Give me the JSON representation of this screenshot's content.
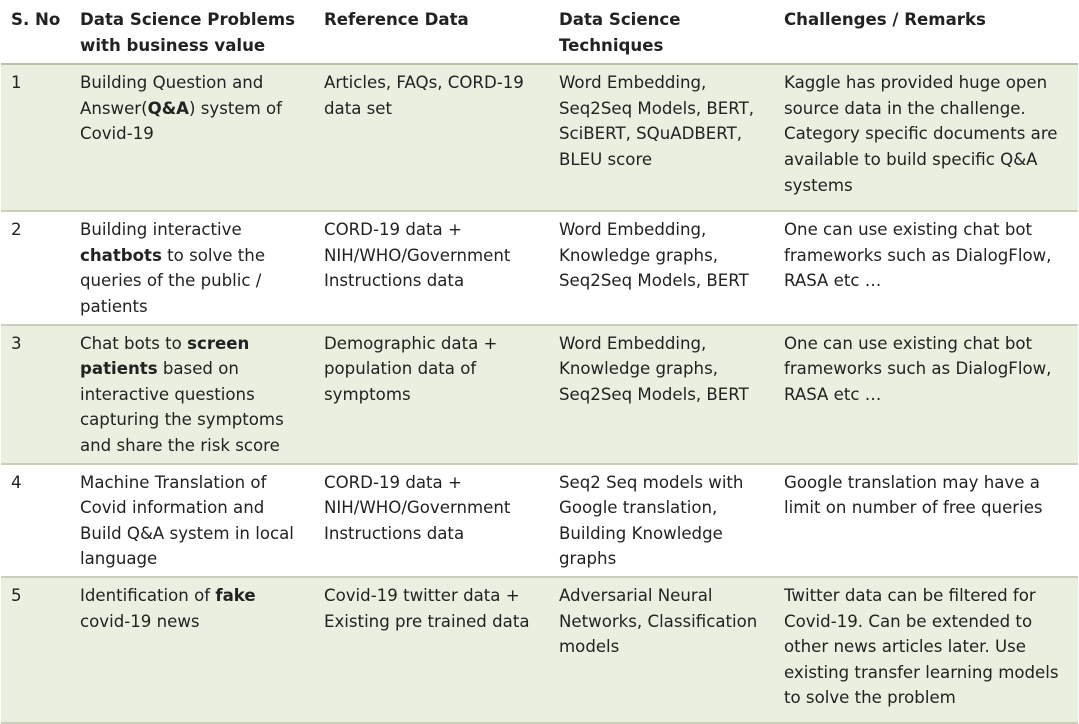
{
  "table": {
    "headers": [
      "S. No",
      "Data Science Problems with business value",
      "Reference Data",
      "Data Science Techniques",
      "Challenges / Remarks"
    ],
    "rows": [
      {
        "sno": "1",
        "problem_pre": "Building Question and Answer(",
        "problem_bold": "Q&A",
        "problem_post": ")  system of Covid-19",
        "reference": "Articles, FAQs, CORD-19 data set",
        "techniques": "Word Embedding, Seq2Seq Models, BERT, SciBERT, SQuADBERT, BLEU score",
        "remarks": "Kaggle has provided huge open source data in the challenge. Category specific documents are available to build specific Q&A systems"
      },
      {
        "sno": "2",
        "problem_pre": "Building interactive ",
        "problem_bold": "chatbots",
        "problem_post": " to solve the queries of the public / patients",
        "reference": "CORD-19 data + NIH/WHO/Government Instructions data",
        "techniques": "Word Embedding, Knowledge graphs, Seq2Seq Models, BERT",
        "remarks": "One can use existing chat bot frameworks such as DialogFlow, RASA etc …"
      },
      {
        "sno": "3",
        "problem_pre": "Chat bots to ",
        "problem_bold": "screen patients",
        "problem_post": " based on interactive questions capturing the symptoms and share the risk score",
        "reference": "Demographic data + population data of symptoms",
        "techniques": "Word Embedding, Knowledge graphs, Seq2Seq Models, BERT",
        "remarks": "One can use existing chat bot frameworks such as DialogFlow, RASA etc …"
      },
      {
        "sno": "4",
        "problem_pre": "Machine Translation of Covid information and Build Q&A system in local language",
        "problem_bold": "",
        "problem_post": "",
        "reference": "CORD-19 data + NIH/WHO/Government Instructions data",
        "techniques": "Seq2 Seq models with Google translation, Building Knowledge graphs",
        "remarks": "Google translation may have a limit on number of free queries"
      },
      {
        "sno": "5",
        "problem_pre": "Identification of ",
        "problem_bold": "fake",
        "problem_post": " covid-19 news",
        "reference": "Covid-19 twitter data + Existing pre trained data",
        "techniques": "Adversarial Neural Networks, Classification models",
        "remarks": "Twitter data can be filtered for Covid-19. Can be extended to other news articles later. Use existing transfer learning models to solve the problem"
      }
    ]
  },
  "colors": {
    "row_shade": "#e9f0df",
    "border": "#c9cfbb",
    "text": "#222222"
  }
}
